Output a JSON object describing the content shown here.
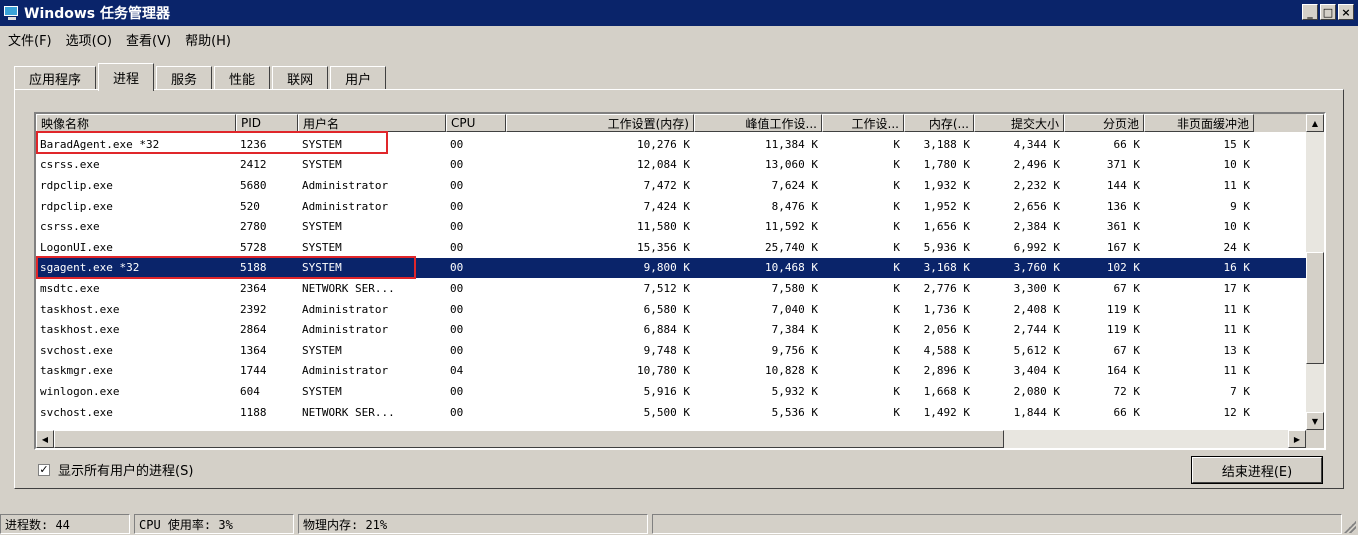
{
  "window": {
    "title": "Windows 任务管理器",
    "buttons": [
      "_",
      "□",
      "×"
    ]
  },
  "menu": [
    "文件(F)",
    "选项(O)",
    "查看(V)",
    "帮助(H)"
  ],
  "tabs": [
    {
      "label": "应用程序",
      "active": false
    },
    {
      "label": "进程",
      "active": true
    },
    {
      "label": "服务",
      "active": false
    },
    {
      "label": "性能",
      "active": false
    },
    {
      "label": "联网",
      "active": false
    },
    {
      "label": "用户",
      "active": false
    }
  ],
  "columns": [
    "映像名称",
    "PID",
    "用户名",
    "CPU",
    "工作设置(内存)",
    "峰值工作设...",
    "工作设...",
    "内存(...",
    "提交大小",
    "分页池",
    "非页面缓冲池"
  ],
  "processes": [
    {
      "name": "BaradAgent.exe *32",
      "pid": "1236",
      "user": "SYSTEM",
      "cpu": "00",
      "ws": "10,276 K",
      "peak": "11,384 K",
      "wsd": "K",
      "mem": "3,188 K",
      "commit": "4,344 K",
      "paged": "66 K",
      "nonpaged": "15 K"
    },
    {
      "name": "csrss.exe",
      "pid": "2412",
      "user": "SYSTEM",
      "cpu": "00",
      "ws": "12,084 K",
      "peak": "13,060 K",
      "wsd": "K",
      "mem": "1,780 K",
      "commit": "2,496 K",
      "paged": "371 K",
      "nonpaged": "10 K"
    },
    {
      "name": "rdpclip.exe",
      "pid": "5680",
      "user": "Administrator",
      "cpu": "00",
      "ws": "7,472 K",
      "peak": "7,624 K",
      "wsd": "K",
      "mem": "1,932 K",
      "commit": "2,232 K",
      "paged": "144 K",
      "nonpaged": "11 K"
    },
    {
      "name": "rdpclip.exe",
      "pid": "520",
      "user": "Administrator",
      "cpu": "00",
      "ws": "7,424 K",
      "peak": "8,476 K",
      "wsd": "K",
      "mem": "1,952 K",
      "commit": "2,656 K",
      "paged": "136 K",
      "nonpaged": "9 K"
    },
    {
      "name": "csrss.exe",
      "pid": "2780",
      "user": "SYSTEM",
      "cpu": "00",
      "ws": "11,580 K",
      "peak": "11,592 K",
      "wsd": "K",
      "mem": "1,656 K",
      "commit": "2,384 K",
      "paged": "361 K",
      "nonpaged": "10 K"
    },
    {
      "name": "LogonUI.exe",
      "pid": "5728",
      "user": "SYSTEM",
      "cpu": "00",
      "ws": "15,356 K",
      "peak": "25,740 K",
      "wsd": "K",
      "mem": "5,936 K",
      "commit": "6,992 K",
      "paged": "167 K",
      "nonpaged": "24 K"
    },
    {
      "name": "sgagent.exe *32",
      "pid": "5188",
      "user": "SYSTEM",
      "cpu": "00",
      "ws": "9,800 K",
      "peak": "10,468 K",
      "wsd": "K",
      "mem": "3,168 K",
      "commit": "3,760 K",
      "paged": "102 K",
      "nonpaged": "16 K"
    },
    {
      "name": "msdtc.exe",
      "pid": "2364",
      "user": "NETWORK SER...",
      "cpu": "00",
      "ws": "7,512 K",
      "peak": "7,580 K",
      "wsd": "K",
      "mem": "2,776 K",
      "commit": "3,300 K",
      "paged": "67 K",
      "nonpaged": "17 K"
    },
    {
      "name": "taskhost.exe",
      "pid": "2392",
      "user": "Administrator",
      "cpu": "00",
      "ws": "6,580 K",
      "peak": "7,040 K",
      "wsd": "K",
      "mem": "1,736 K",
      "commit": "2,408 K",
      "paged": "119 K",
      "nonpaged": "11 K"
    },
    {
      "name": "taskhost.exe",
      "pid": "2864",
      "user": "Administrator",
      "cpu": "00",
      "ws": "6,884 K",
      "peak": "7,384 K",
      "wsd": "K",
      "mem": "2,056 K",
      "commit": "2,744 K",
      "paged": "119 K",
      "nonpaged": "11 K"
    },
    {
      "name": "svchost.exe",
      "pid": "1364",
      "user": "SYSTEM",
      "cpu": "00",
      "ws": "9,748 K",
      "peak": "9,756 K",
      "wsd": "K",
      "mem": "4,588 K",
      "commit": "5,612 K",
      "paged": "67 K",
      "nonpaged": "13 K"
    },
    {
      "name": "taskmgr.exe",
      "pid": "1744",
      "user": "Administrator",
      "cpu": "04",
      "ws": "10,780 K",
      "peak": "10,828 K",
      "wsd": "K",
      "mem": "2,896 K",
      "commit": "3,404 K",
      "paged": "164 K",
      "nonpaged": "11 K"
    },
    {
      "name": "winlogon.exe",
      "pid": "604",
      "user": "SYSTEM",
      "cpu": "00",
      "ws": "5,916 K",
      "peak": "5,932 K",
      "wsd": "K",
      "mem": "1,668 K",
      "commit": "2,080 K",
      "paged": "72 K",
      "nonpaged": "7 K"
    },
    {
      "name": "svchost.exe",
      "pid": "1188",
      "user": "NETWORK SER...",
      "cpu": "00",
      "ws": "5,500 K",
      "peak": "5,536 K",
      "wsd": "K",
      "mem": "1,492 K",
      "commit": "1,844 K",
      "paged": "66 K",
      "nonpaged": "12 K"
    }
  ],
  "selected_index": 6,
  "show_all_users": {
    "label": "显示所有用户的进程(S)",
    "checked": true
  },
  "end_process_label": "结束进程(E)",
  "status": {
    "processes": "进程数: 44",
    "cpu": "CPU 使用率: 3%",
    "memory": "物理内存: 21%"
  },
  "colors": {
    "highlight_box": "#e0262a",
    "selection": "#0a246a",
    "titlebar": "#0a246a"
  }
}
